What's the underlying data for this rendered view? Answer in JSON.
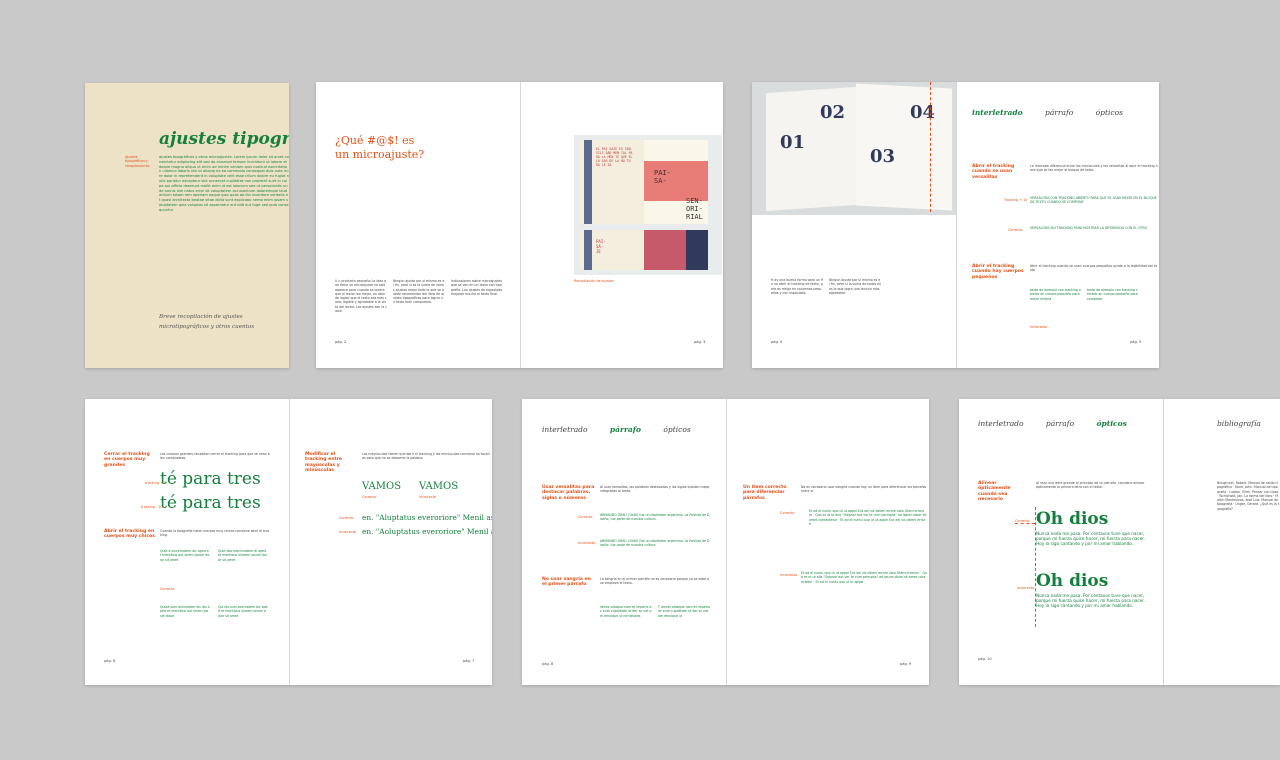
{
  "colors": {
    "background": "#c9c9c9",
    "orange": "#e0521a",
    "green": "#15803d",
    "cover": "#ede2c6"
  },
  "cover": {
    "title": "ajustes tipográfic",
    "side_note": "Ajustes tipográficos y recopilaciones",
    "subtitle_line1": "Breve recopilación de ajustes",
    "subtitle_line2": "microtipográficos y otros cuentos"
  },
  "spread1": {
    "heading_line1": "¿Qué #@$! es",
    "heading_line2": "un microajuste?",
    "folio_left": "pág. 2",
    "folio_right": "pág. 3",
    "book_left_lines": [
      "PAI-",
      "SA-",
      "JE"
    ],
    "book_right_lines": [
      "PAI-",
      "SA-",
      "SEN-",
      "ORI-",
      "RIAL"
    ],
    "caption": "Recopilación de ajustes"
  },
  "spread2": {
    "nums": [
      "02",
      "04",
      "01",
      "03"
    ],
    "tabs": [
      "interletrado",
      "párrafo",
      "ópticos"
    ],
    "section1": "Abrir el tracking cuando se usan versalitas",
    "section2": "Abrir el tracking cuando hay cuerpos pequeños",
    "label_tracking": "Tracking + 10",
    "label_correcto": "Correcto",
    "label_incorrecto": "Incorrecto",
    "folio_left": "pág. 4",
    "folio_right": "pág. 5"
  },
  "spread3": {
    "section1": "Cerrar el tracking en cuerpos muy grandes",
    "big_text": "té para tres",
    "label_tracking_a": "tracking + 0",
    "label_tracking_b": "tracking - 10",
    "label_correcto": "Correcto",
    "section2": "Abrir el tracking en cuerpos muy chicos",
    "section3": "Modificar el tracking entre mayúsculas y minúsculas",
    "vamos": "VAMOS",
    "line1": "en. \"Aluptatus everoriore\" Menil as aces e",
    "line2": "en. \"Aoluptatus everoriore\" Menil as aces e",
    "label_incorrecto": "Incorrecto",
    "folio_left": "pág. 6",
    "folio_right": "pág. 7"
  },
  "spread4": {
    "tabs": [
      "interletrado",
      "párrafo",
      "ópticos"
    ],
    "section1": "Usar versalitas para destacar palabras, siglas o números",
    "section2": "No usar sangría en el primer párrafo",
    "section3": "Un ítem correcto para diferenciar párrafos",
    "label_correcto": "Correcto",
    "label_incorrecto": "Incorrecto",
    "folio_left": "pág. 8",
    "folio_right": "pág. 9"
  },
  "spread5": {
    "tabs": [
      "interletrado",
      "párrafo",
      "ópticos"
    ],
    "tab_biblio": "bibliografía",
    "section1": "Alinear ópticamente cuando sea necesario",
    "big_text": "Oh dios",
    "label_correcto": "Correcto",
    "label_incorrecto": "Incorrecto",
    "para_text": "Nunca nada me pasa. Por centavos tuve que nacer, porque mi fuerza quise hacer, mi fuerza para nacer. Hoy la sigo cantando y por mi amor hablando.",
    "folio_left": "pág. 10"
  }
}
